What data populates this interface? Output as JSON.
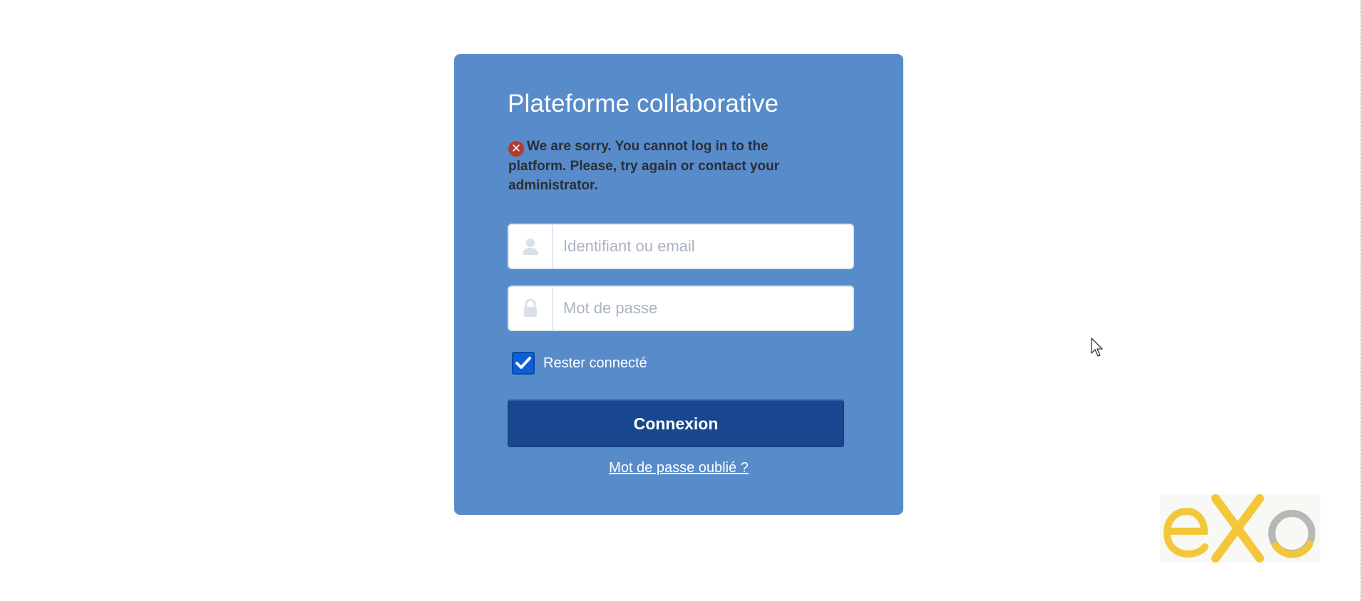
{
  "card": {
    "title": "Plateforme collaborative",
    "error": {
      "icon": "error-circle-icon",
      "icon_glyph": "✕",
      "message": "We are sorry. You cannot log in to the platform. Please, try again or contact your administrator."
    },
    "username": {
      "icon": "user-icon",
      "placeholder": "Identifiant ou email",
      "value": ""
    },
    "password": {
      "icon": "lock-icon",
      "placeholder": "Mot de passe",
      "value": ""
    },
    "remember": {
      "label": "Rester connecté",
      "checked": true
    },
    "submit_label": "Connexion",
    "forgot_label": "Mot de passe oublié ?"
  },
  "logo": {
    "text": "eXo",
    "colors": {
      "yellow": "#f3c73a",
      "gray": "#b7b7b7"
    }
  },
  "colors": {
    "card_background": "#588bc9",
    "button_background": "#19478f",
    "checkbox_background": "#0d5fd6",
    "error_icon": "#b23a32"
  }
}
